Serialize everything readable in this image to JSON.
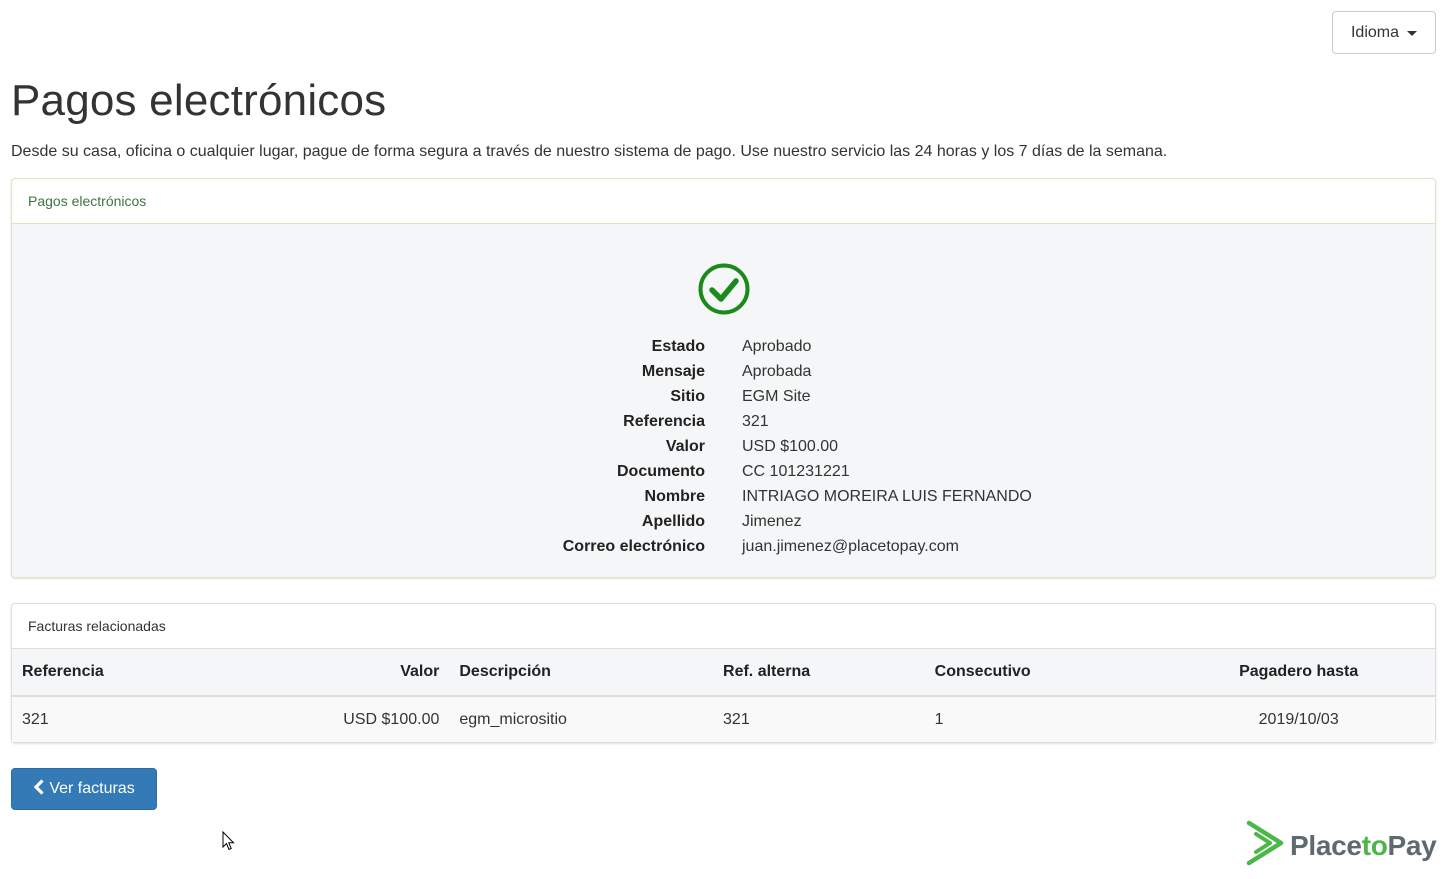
{
  "language_menu": {
    "label": "Idioma"
  },
  "header": {
    "title": "Pagos electrónicos",
    "lead": "Desde su casa, oficina o cualquier lugar, pague de forma segura a través de nuestro sistema de pago. Use nuestro servicio las 24 horas y los 7 días de la semana."
  },
  "payment_panel": {
    "heading": "Pagos electrónicos",
    "status_icon": "check-circle-icon",
    "details": [
      {
        "label": "Estado",
        "value": "Aprobado"
      },
      {
        "label": "Mensaje",
        "value": "Aprobada"
      },
      {
        "label": "Sitio",
        "value": "EGM Site"
      },
      {
        "label": "Referencia",
        "value": "321"
      },
      {
        "label": "Valor",
        "value": "USD $100.00"
      },
      {
        "label": "Documento",
        "value": "CC 101231221"
      },
      {
        "label": "Nombre",
        "value": "INTRIAGO MOREIRA LUIS FERNANDO"
      },
      {
        "label": "Apellido",
        "value": "Jimenez"
      },
      {
        "label": "Correo electrónico",
        "value": "juan.jimenez@placetopay.com"
      }
    ]
  },
  "invoices_panel": {
    "heading": "Facturas relacionadas",
    "columns": [
      "Referencia",
      "Valor",
      "Descripción",
      "Ref. alterna",
      "Consecutivo",
      "Pagadero hasta"
    ],
    "rows": [
      [
        "321",
        "USD $100.00",
        "egm_micrositio",
        "321",
        "1",
        "2019/10/03"
      ]
    ]
  },
  "actions": {
    "view_invoices_label": "Ver facturas",
    "view_invoices_icon": "chevron-left-icon"
  },
  "branding": {
    "logo_part1": "Place",
    "logo_part2": "to",
    "logo_part3": "Pay"
  },
  "colors": {
    "success_green": "#4cb648",
    "check_green": "#1a8a1a",
    "primary_blue": "#337ab7",
    "panel_success_border": "#d6e9c6",
    "panel_heading_green": "#3c763d"
  }
}
